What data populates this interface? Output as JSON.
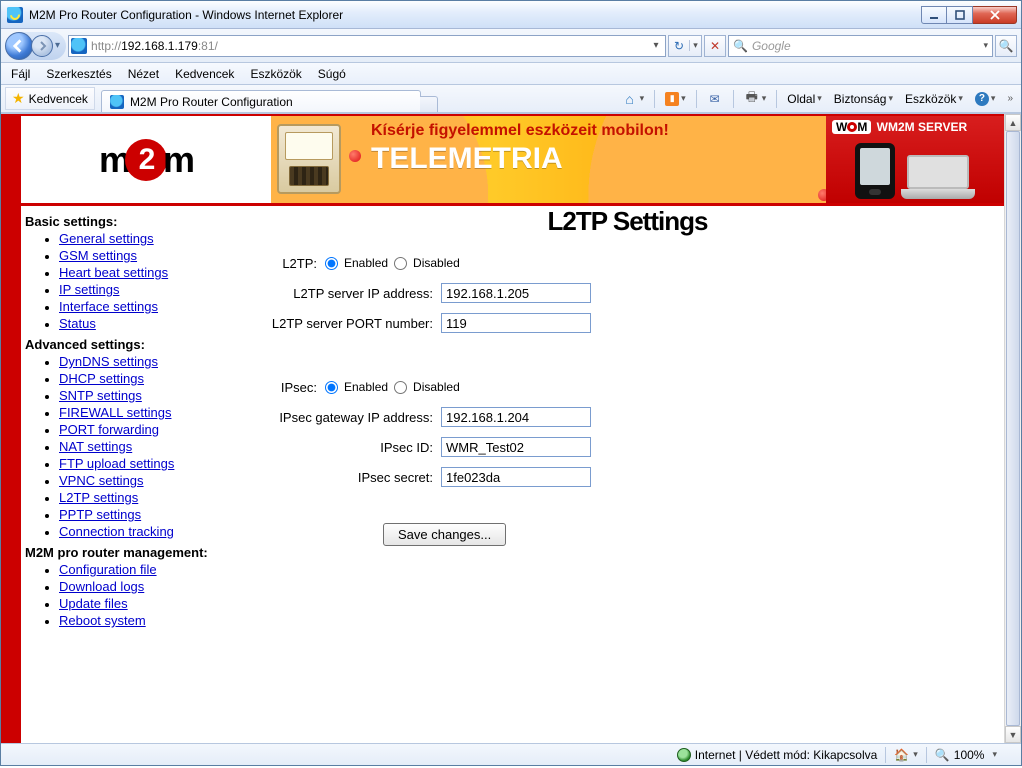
{
  "window": {
    "title": "M2M Pro Router Configuration - Windows Internet Explorer"
  },
  "address": {
    "scheme_prefix": "http://",
    "host": "192.168.1.179",
    "port_suffix": ":81/"
  },
  "search": {
    "placeholder": "Google"
  },
  "menu": {
    "file": "Fájl",
    "edit": "Szerkesztés",
    "view": "Nézet",
    "favorites": "Kedvencek",
    "tools": "Eszközök",
    "help": "Súgó"
  },
  "favorites_btn": "Kedvencek",
  "tab": {
    "title": "M2M Pro Router Configuration"
  },
  "cmdbar": {
    "page": "Oldal",
    "safety": "Biztonság",
    "tools": "Eszközök"
  },
  "banner": {
    "line1": "Kísérje figyelemmel eszközeit mobilon!",
    "line2": "TELEMETRIA",
    "server_brand": "WM2M SERVER"
  },
  "sidebar": {
    "basic_heading": "Basic settings:",
    "basic": [
      "General settings",
      "GSM settings",
      "Heart beat settings",
      "IP settings",
      "Interface settings",
      "Status"
    ],
    "advanced_heading": "Advanced settings:",
    "advanced": [
      "DynDNS settings",
      "DHCP settings",
      "SNTP settings",
      "FIREWALL settings",
      "PORT forwarding",
      "NAT settings",
      "FTP upload settings",
      "VPNC settings",
      "L2TP settings",
      "PPTP settings",
      "Connection tracking"
    ],
    "mgmt_heading": "M2M pro router management:",
    "mgmt": [
      "Configuration file",
      "Download logs",
      "Update files",
      "Reboot system"
    ]
  },
  "page": {
    "heading": "L2TP Settings",
    "l2tp_label": "L2TP:",
    "enabled": "Enabled",
    "disabled": "Disabled",
    "l2tp_state": "enabled",
    "l2tp_server_ip_label": "L2TP server IP address:",
    "l2tp_server_ip": "192.168.1.205",
    "l2tp_port_label": "L2TP server PORT number:",
    "l2tp_port": "119",
    "ipsec_label": "IPsec:",
    "ipsec_state": "enabled",
    "ipsec_gw_label": "IPsec gateway IP address:",
    "ipsec_gw": "192.168.1.204",
    "ipsec_id_label": "IPsec ID:",
    "ipsec_id": "WMR_Test02",
    "ipsec_secret_label": "IPsec secret:",
    "ipsec_secret": "1fe023da",
    "save": "Save changes..."
  },
  "status": {
    "zone": "Internet | Védett mód: Kikapcsolva",
    "zoom": "100%"
  }
}
